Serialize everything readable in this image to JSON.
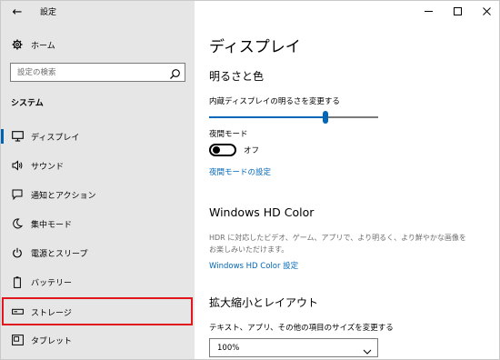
{
  "window": {
    "title": "設定"
  },
  "sidebar": {
    "home_label": "ホーム",
    "search_placeholder": "設定の検索",
    "section_title": "システム",
    "items": [
      {
        "label": "ディスプレイ",
        "icon": "monitor-icon",
        "selected": true
      },
      {
        "label": "サウンド",
        "icon": "speaker-icon"
      },
      {
        "label": "通知とアクション",
        "icon": "notification-icon"
      },
      {
        "label": "集中モード",
        "icon": "moon-icon"
      },
      {
        "label": "電源とスリープ",
        "icon": "power-icon"
      },
      {
        "label": "バッテリー",
        "icon": "battery-icon"
      },
      {
        "label": "ストレージ",
        "icon": "storage-icon",
        "highlighted": true,
        "highlight_color": "#e0181e"
      },
      {
        "label": "タブレット",
        "icon": "tablet-icon"
      }
    ]
  },
  "main": {
    "title": "ディスプレイ",
    "brightness": {
      "heading": "明るさと色",
      "slider_label": "内蔵ディスプレイの明るさを変更する",
      "value_fraction": 0.69
    },
    "night_mode": {
      "label": "夜間モード",
      "state": "オフ",
      "settings_link": "夜間モードの設定"
    },
    "hd_color": {
      "heading": "Windows HD Color",
      "description": "HDR に対応したビデオ、ゲーム、アプリで、より明るく、より鮮やかな画像をお楽しみいただけます。",
      "link": "Windows HD Color 設定"
    },
    "scale": {
      "heading": "拡大縮小とレイアウト",
      "label": "テキスト、アプリ、その他の項目のサイズを変更する",
      "selected_value": "100%"
    }
  },
  "colors": {
    "sidebar_bg": "#e6e6e6",
    "accent": "#0067b8",
    "highlight": "#e0181e"
  }
}
